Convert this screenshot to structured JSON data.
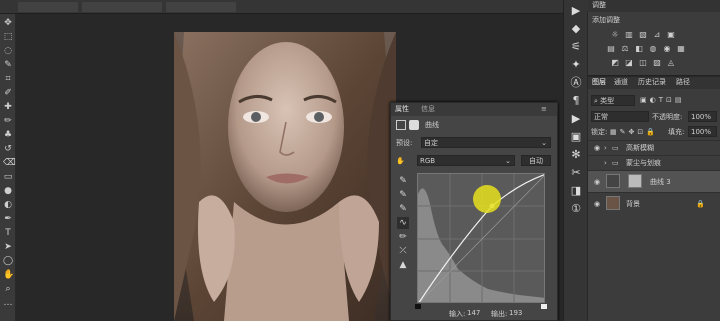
{
  "topbar": {
    "tabs": [
      "",
      "",
      ""
    ]
  },
  "toolbar": {
    "tools": [
      "move-tool-icon",
      "marquee-tool-icon",
      "lasso-tool-icon",
      "quick-select-tool-icon",
      "crop-tool-icon",
      "eyedropper-tool-icon",
      "healing-brush-icon",
      "brush-tool-icon",
      "clone-stamp-icon",
      "history-brush-icon",
      "eraser-tool-icon",
      "gradient-tool-icon",
      "blur-tool-icon",
      "dodge-tool-icon",
      "pen-tool-icon",
      "type-tool-icon",
      "path-select-icon",
      "shape-tool-icon",
      "hand-tool-icon",
      "zoom-tool-icon",
      "more-tools-icon"
    ],
    "glyphs": [
      "✥",
      "⬚",
      "◌",
      "✎",
      "⌗",
      "✐",
      "✚",
      "✏",
      "♣",
      "↺",
      "⌫",
      "▭",
      "●",
      "◐",
      "✒",
      "T",
      "➤",
      "◯",
      "✋",
      "⌕",
      "…"
    ]
  },
  "adjustments_panel": {
    "tab": "调整",
    "subtitle": "添加调整",
    "icons_row1": [
      "☼",
      "▥",
      "▧",
      "⊿",
      "▣"
    ],
    "icons_row2": [
      "▤",
      "⚖",
      "◧",
      "◍",
      "◉",
      "▦"
    ],
    "icons_row3": [
      "◩",
      "◪",
      "◫",
      "▨",
      "◬"
    ]
  },
  "layers_panel": {
    "tabs": [
      "图层",
      "通道",
      "历史记录",
      "路径"
    ],
    "kind_filter": "类型",
    "blend_mode": "正常",
    "opacity_label": "不透明度:",
    "opacity_value": "100%",
    "lock_label": "锁定:",
    "fill_label": "填充:",
    "fill_value": "100%",
    "layers": [
      {
        "name": "高斯模糊",
        "type": "group"
      },
      {
        "name": "蒙尘与划痕",
        "type": "group"
      },
      {
        "name": "曲线 3",
        "type": "adjustment"
      },
      {
        "name": "背景",
        "type": "image"
      }
    ]
  },
  "properties_panel": {
    "tabs": [
      "属性",
      "信息"
    ],
    "title": "曲线",
    "preset_label": "预设:",
    "preset_value": "自定",
    "channel_value": "RGB",
    "auto_button": "自动",
    "input_label": "输入:",
    "input_value": "147",
    "output_label": "输出:",
    "output_value": "193",
    "tools": [
      "✎",
      "✎",
      "✎",
      "∿",
      "✏",
      "⤫",
      "▲"
    ]
  },
  "right_strip": {
    "icons": [
      "▶",
      "◆",
      "⚟",
      "✦",
      "Ⓐ",
      "¶",
      "▶",
      "▣",
      "✻",
      "✂",
      "◨",
      "①"
    ]
  }
}
